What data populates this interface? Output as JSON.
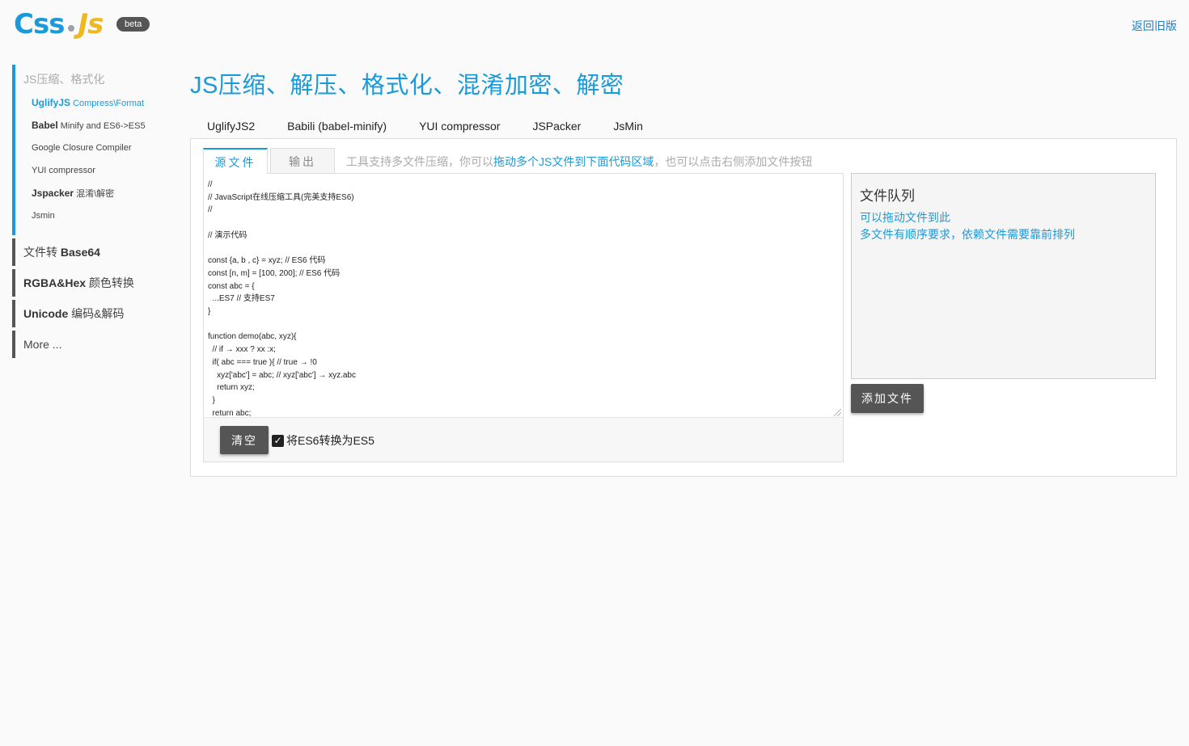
{
  "header": {
    "logo_css": "Css",
    "logo_js": "Js",
    "beta": "beta",
    "back_link": "返回旧版"
  },
  "sidebar": {
    "group_title": "JS压缩、格式化",
    "sub_items": [
      {
        "bold": "UglifyJS",
        "rest": " Compress\\Format",
        "active": true
      },
      {
        "bold": "Babel",
        "rest": " Minify and ES6->ES5"
      },
      {
        "bold": "",
        "rest": "Google Closure Compiler"
      },
      {
        "bold": "",
        "rest": "YUI compressor"
      },
      {
        "bold": "Jspacker",
        "rest": " 混淆\\解密"
      },
      {
        "bold": "",
        "rest": "Jsmin"
      }
    ],
    "items": [
      {
        "pre": "文件转 ",
        "bold": "Base64",
        "post": ""
      },
      {
        "pre": "",
        "bold": "RGBA&Hex",
        "post": " 颜色转换"
      },
      {
        "pre": "",
        "bold": "Unicode",
        "post": " 编码&解码"
      },
      {
        "pre": "More ...",
        "bold": "",
        "post": ""
      }
    ]
  },
  "main": {
    "title": "JS压缩、解压、格式化、混淆加密、解密",
    "tool_tabs": [
      "UglifyJS2",
      "Babili (babel-minify)",
      "YUI compressor",
      "JSPacker",
      "JsMin"
    ],
    "sub_tabs": {
      "source": "源文件",
      "output": "输出"
    },
    "hint_pre": "工具支持多文件压缩，你可以",
    "hint_highlight": "拖动多个JS文件到下面代码区域",
    "hint_post": "，也可以点击右侧添加文件按钮",
    "code": "//\n// JavaScript在线压缩工具(完美支持ES6)\n//\n\n// 演示代码\n\nconst {a, b , c} = xyz; // ES6 代码\nconst [n, m] = [100, 200]; // ES6 代码\nconst abc = {\n  ...ES7 // 支持ES7\n}\n\nfunction demo(abc, xyz){\n  // if → xxx ? xx :x;\n  if( abc === true ){ // true → !0\n    xyz['abc'] = abc; // xyz['abc'] → xyz.abc\n    return xyz;\n  }\n  return abc;\n}",
    "clear_button": "清空",
    "es6_label": "将ES6转换为ES5",
    "es6_checked": true,
    "queue": {
      "title": "文件队列",
      "line1": "可以拖动文件到此",
      "line2": "多文件有顺序要求，依赖文件需要靠前排列"
    },
    "add_button": "添加文件"
  }
}
